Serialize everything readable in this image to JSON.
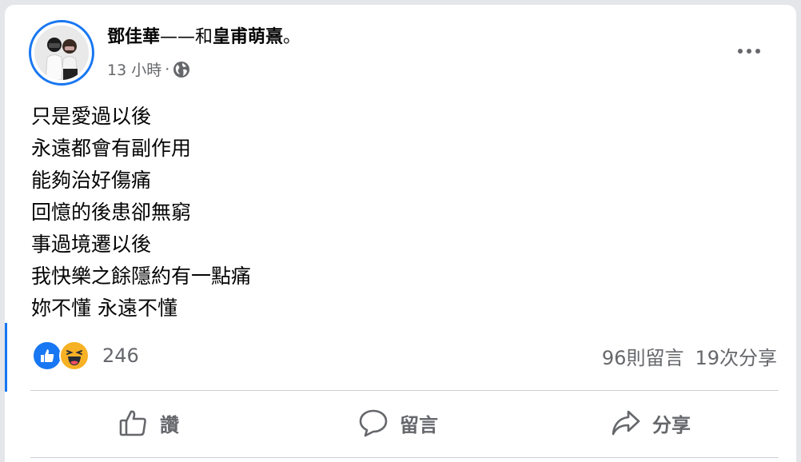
{
  "post": {
    "author": "鄧佳華",
    "connector": "——和",
    "tagged": "皇甫萌熹",
    "period": "。",
    "time": "13 小時",
    "separator": "·",
    "privacy_icon": "globe-icon",
    "lines": [
      "只是愛過以後",
      "永遠都會有副作用",
      "能夠治好傷痛",
      "回憶的後患卻無窮",
      "事過境遷以後",
      "我快樂之餘隱約有一點痛",
      "妳不懂 永遠不懂"
    ]
  },
  "reactions": {
    "icons": [
      "like-icon",
      "haha-icon"
    ],
    "count": "246",
    "comments": "96則留言",
    "shares": "19次分享"
  },
  "actions": {
    "like": "讚",
    "comment": "留言",
    "share": "分享"
  },
  "colors": {
    "brand": "#1877f2",
    "secondary_text": "#65676b",
    "haha": "#f7b125"
  }
}
